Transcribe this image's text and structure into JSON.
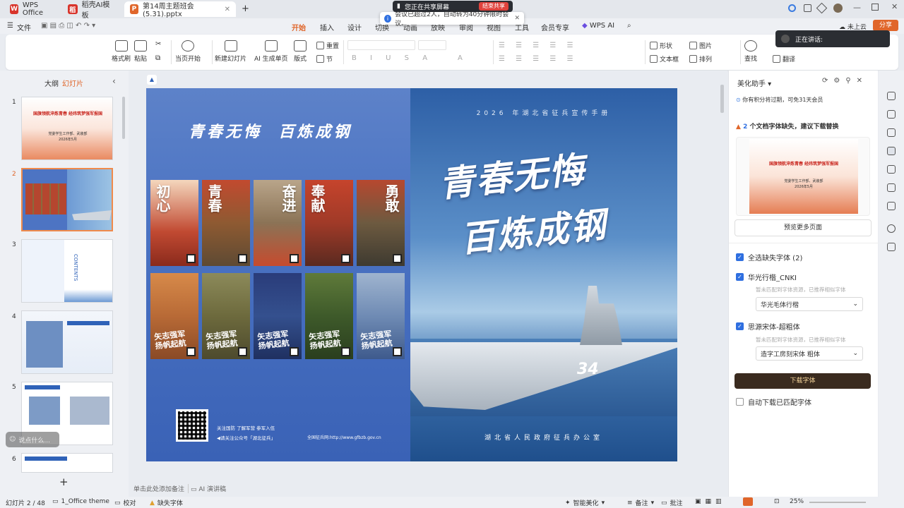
{
  "window": {
    "tabs": [
      {
        "label": "WPS Office",
        "icon": "wps-logo-icon"
      },
      {
        "label": "稻壳AI模板",
        "icon": "docer-logo-icon"
      },
      {
        "label": "第14周主题班会(5.31).pptx",
        "icon": "pptx-file-icon"
      }
    ],
    "share_banner": {
      "text": "您正在共享屏幕",
      "end_label": "结束共享"
    },
    "notice": "会议已超过2人，自动转为40分钟限时会议。"
  },
  "menu": {
    "file": "文件",
    "tabs": [
      "开始",
      "插入",
      "设计",
      "切换",
      "动画",
      "放映",
      "审阅",
      "视图",
      "工具",
      "会员专享",
      "WPS AI"
    ],
    "active": "开始",
    "cloud": "未上云",
    "share": "分享"
  },
  "speaking": {
    "label": "正在讲话:"
  },
  "ribbon": {
    "format_painter": "格式刷",
    "paste": "粘贴",
    "start_from_current": "当页开始",
    "new_slide": "新建幻灯片",
    "ai_generate": "AI 生成单页",
    "layout": "版式",
    "reset": "重置",
    "section": "节",
    "shape": "形状",
    "picture": "图片",
    "textbox": "文本框",
    "arrange": "排列",
    "find": "查找",
    "translate": "翻译"
  },
  "left_panel": {
    "outline_tab": "大纲",
    "slides_tab": "幻灯片",
    "slide_numbers": [
      "1",
      "2",
      "3",
      "4",
      "5",
      "6"
    ],
    "selected_index": 2,
    "thumb1_title": "国旗领航淬炼青春 经纬筑梦强军报国",
    "thumb1_sub": "党委学生工作部、武装部",
    "thumb1_date": "2026年5月",
    "thumb3_word": "CONTENTS",
    "comment_prompt": "说点什么..."
  },
  "slide": {
    "left_headline": "青春无悔  百炼成钢",
    "posters_top": [
      "初心",
      "青春",
      "奋进",
      "奉献",
      "勇敢"
    ],
    "posters_bottom_script": "矢志强军\n扬帆起航",
    "footer_line1": "关注国防 了解军营 参军入伍",
    "footer_line2": "◀请关注公众号「湖北征兵」",
    "footer_site": "全国征兵网:http://www.gfbzb.gov.cn",
    "right_subtitle": "2026 年湖北省征兵宣传手册",
    "right_big1": "青春无悔",
    "right_big2": "百炼成钢",
    "right_footer": "湖北省人民政府征兵办公室",
    "ship_number": "34"
  },
  "notes": {
    "placeholder": "单击此处添加备注",
    "ai_script": "AI 演讲稿"
  },
  "right_panel": {
    "title": "美化助手",
    "points_notice": "你有积分将过期，可免31天会员",
    "missing_count": "2",
    "missing_text": "个文档字体缺失，建议下载替换",
    "preview_more": "预览更多页面",
    "select_all": "全选缺失字体 (2)",
    "font1": "华光行楷_CNKI",
    "font1_hint": "暂未匹配到字体资源，已推荐相似字体",
    "font1_sub": "华光毛体行楷",
    "font2": "思源宋体-超粗体",
    "font2_hint": "暂未匹配到字体资源，已推荐相似字体",
    "font2_sub": "造字工房刻宋体 粗体",
    "download": "下载字体",
    "auto_download": "自动下载已匹配字体"
  },
  "status": {
    "slide_pos": "幻灯片 2 / 48",
    "theme": "1_Office theme",
    "proof": "校对",
    "missing_font": "缺失字体",
    "smart_beautify": "智能美化",
    "notes": "备注",
    "comments": "批注",
    "zoom": "25%"
  },
  "colors": {
    "accent": "#e0662a",
    "blue": "#2f6fe0",
    "download_btn": "#3a2b1f"
  }
}
